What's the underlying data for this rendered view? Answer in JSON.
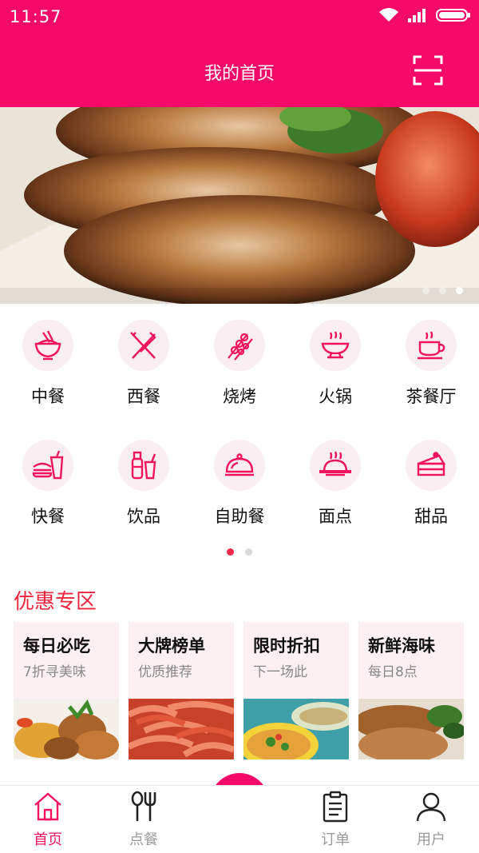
{
  "status_bar": {
    "time": "11:57",
    "icons": [
      "wifi-icon",
      "signal-icon",
      "battery-icon"
    ]
  },
  "header": {
    "title": "我的首页",
    "scan_icon": "scan-icon"
  },
  "banner": {
    "image": "grilled-chicken-photo",
    "dots": 3,
    "active_dot": 3
  },
  "categories": {
    "items": [
      {
        "label": "中餐",
        "icon": "rice-bowl-icon"
      },
      {
        "label": "西餐",
        "icon": "fork-knife-icon"
      },
      {
        "label": "烧烤",
        "icon": "skewer-icon"
      },
      {
        "label": "火锅",
        "icon": "hotpot-icon"
      },
      {
        "label": "茶餐厅",
        "icon": "tea-cup-icon"
      },
      {
        "label": "快餐",
        "icon": "fast-food-icon"
      },
      {
        "label": "饮品",
        "icon": "drinks-icon"
      },
      {
        "label": "自助餐",
        "icon": "cloche-icon"
      },
      {
        "label": "面点",
        "icon": "bun-icon"
      },
      {
        "label": "甜品",
        "icon": "cake-icon"
      }
    ],
    "pages": 2,
    "active_page": 1
  },
  "promo": {
    "title": "优惠专区",
    "cards": [
      {
        "name": "每日必吃",
        "sub": "7折寻美味",
        "image": "fried-chicken-photo"
      },
      {
        "name": "大牌榜单",
        "sub": "优质推荐",
        "image": "shrimp-photo"
      },
      {
        "name": "限时折扣",
        "sub": "下一场此",
        "image": "soup-photo"
      },
      {
        "name": "新鲜海味",
        "sub": "每日8点",
        "image": "grill-photo"
      }
    ]
  },
  "bottom_nav": {
    "items": [
      {
        "label": "首页",
        "icon": "home-icon",
        "active": true
      },
      {
        "label": "点餐",
        "icon": "utensils-icon",
        "active": false
      },
      {
        "label": "订单",
        "icon": "clipboard-icon",
        "active": false
      },
      {
        "label": "用户",
        "icon": "user-icon",
        "active": false
      }
    ],
    "fab_icon": "plus-icon"
  },
  "colors": {
    "brand": "#f50a6a",
    "promo_title": "#f0233c",
    "card_bg": "#fdf0f2"
  }
}
